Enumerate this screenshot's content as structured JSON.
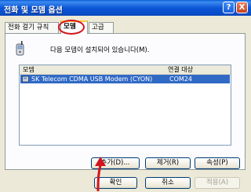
{
  "window": {
    "title": "전화 및 모뎀 옵션",
    "help_label": "?",
    "close_label": "X"
  },
  "tabs": [
    {
      "label": "전화 걸기 규칙"
    },
    {
      "label": "모뎀",
      "selected": true
    },
    {
      "label": "고급"
    }
  ],
  "panel": {
    "info_text": "다음 모뎀이 설치되어 있습니다(M).",
    "list": {
      "columns": [
        "모뎀",
        "연결 대상"
      ],
      "rows": [
        {
          "modem": "SK Telecom CDMA USB Modem (CYON)",
          "port": "COM24",
          "selected": true
        }
      ]
    },
    "buttons": {
      "add": "추가(D)...",
      "remove": "제거(R)",
      "properties": "속성(P)"
    }
  },
  "dialog_buttons": {
    "ok": "확인",
    "cancel": "취소",
    "apply": "적용(A)"
  },
  "annotation": {
    "circle_color": "#d4141c",
    "arrow_color": "#d4141c"
  },
  "colors": {
    "selection": "#316ac5",
    "titlebar": "#0a4fc9"
  }
}
